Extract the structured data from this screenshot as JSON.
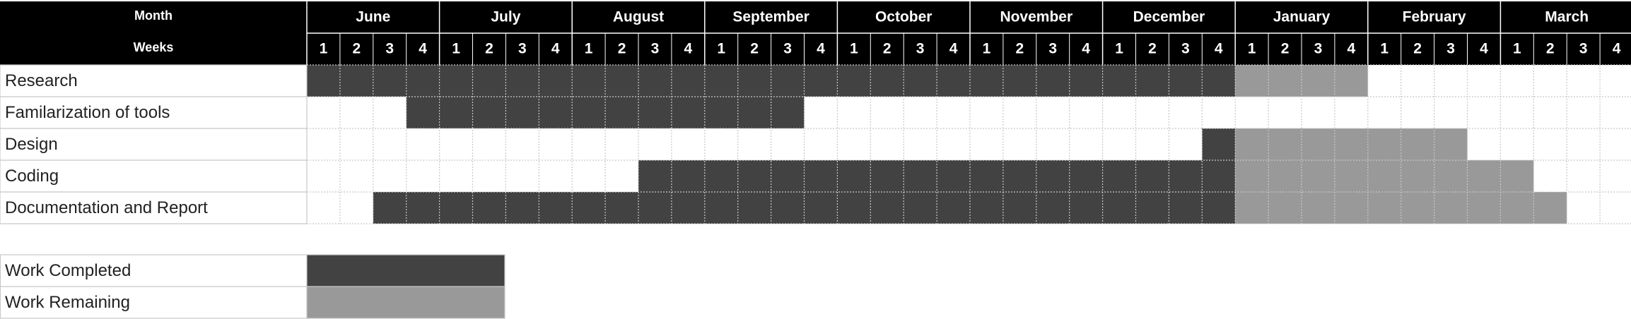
{
  "chart_data": {
    "type": "gantt",
    "header": {
      "month_label": "Month",
      "weeks_label": "Weeks"
    },
    "months": [
      "June",
      "July",
      "August",
      "September",
      "October",
      "November",
      "December",
      "January",
      "February",
      "March"
    ],
    "weeks_per_month": [
      1,
      2,
      3,
      4
    ],
    "tasks": [
      {
        "name": "Research",
        "completed": [
          1,
          28
        ],
        "remaining": [
          29,
          32
        ]
      },
      {
        "name": "Familarization of tools",
        "completed": [
          4,
          15
        ],
        "remaining": null
      },
      {
        "name": "Design",
        "completed": [
          28,
          28
        ],
        "remaining": [
          29,
          35
        ]
      },
      {
        "name": "Coding",
        "completed": [
          11,
          28
        ],
        "remaining": [
          29,
          37
        ]
      },
      {
        "name": "Documentation and Report",
        "completed": [
          3,
          28
        ],
        "remaining": [
          29,
          38
        ]
      }
    ],
    "legend": [
      {
        "label": "Work Completed",
        "color": "#424242"
      },
      {
        "label": "Work Remaining",
        "color": "#999999"
      }
    ],
    "colors": {
      "header_bg": "#000000",
      "header_text": "#ffffff",
      "completed": "#424242",
      "remaining": "#999999",
      "grid": "#c8c8c8"
    }
  }
}
